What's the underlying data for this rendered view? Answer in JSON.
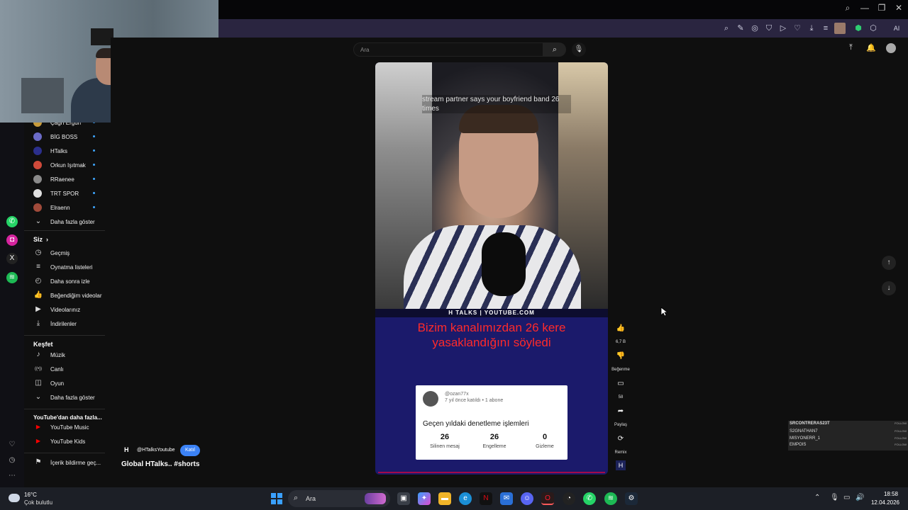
{
  "youtube": {
    "search_placeholder": "Ara",
    "sidebar": {
      "subscriptions": [
        {
          "label": "Çağrı Ergün",
          "color": "#c79b3b"
        },
        {
          "label": "BİG BOSS",
          "color": "#6b6bc7"
        },
        {
          "label": "HTalks",
          "color": "#2b2f8c"
        },
        {
          "label": "Orkun Işıtmak",
          "color": "#d04a3a"
        },
        {
          "label": "RRaenee",
          "color": "#8a8a8a"
        },
        {
          "label": "TRT SPOR",
          "color": "#e0e0e0"
        },
        {
          "label": "Elraenn",
          "color": "#a04a3a"
        }
      ],
      "show_more": "Daha fazla göster",
      "you_title": "Siz",
      "you_items": [
        {
          "label": "Geçmiş",
          "icon": "history-icon"
        },
        {
          "label": "Oynatma listeleri",
          "icon": "playlist-icon"
        },
        {
          "label": "Daha sonra izle",
          "icon": "clock-icon"
        },
        {
          "label": "Beğendiğim videolar",
          "icon": "like-icon"
        },
        {
          "label": "Videolarınız",
          "icon": "video-icon"
        },
        {
          "label": "İndirilenler",
          "icon": "download-icon"
        }
      ],
      "explore_title": "Keşfet",
      "explore_items": [
        {
          "label": "Müzik",
          "icon": "music-icon"
        },
        {
          "label": "Canlı",
          "icon": "live-icon"
        },
        {
          "label": "Oyun",
          "icon": "gamepad-icon"
        },
        {
          "label": "Daha fazla göster",
          "icon": "chevron-down-icon"
        }
      ],
      "more_title": "YouTube'dan daha fazla...",
      "more_items": [
        {
          "label": "YouTube Music",
          "color": "#ff0000"
        },
        {
          "label": "YouTube Kids",
          "color": "#ff0000"
        }
      ],
      "report_label": "İçerik bildirme geç..."
    },
    "short": {
      "caption": "stream partner says your boyfriend band 26 times",
      "banner": "H TALKS | YOUTUBE.COM",
      "red_text_line1": "Bizim kanalımızdan 26 kere",
      "red_text_line2": "yasaklandığını söyledi",
      "card": {
        "name": "@ozan77x",
        "meta": "7 yıl önce katıldı • 1 abone",
        "title": "Geçen yıldaki denetleme işlemleri",
        "stats": [
          {
            "value": "26",
            "label": "Silinen mesaj"
          },
          {
            "value": "26",
            "label": "Engelleme"
          },
          {
            "value": "0",
            "label": "Gizleme"
          }
        ]
      },
      "actions": {
        "like_count": "6,7 B",
        "dislike_label": "Beğenme",
        "comment_count": "58",
        "share_label": "Paylaş",
        "remix_label": "Remix"
      },
      "channel_handle": "@HTalksYoutube",
      "join_label": "Katıl",
      "title": "Global HTalks.. #shorts"
    }
  },
  "follow_overlay": {
    "rows": [
      {
        "name": "SRCONTRERAS23T",
        "btn": "FOLLOW"
      },
      {
        "name": "S2GNATHAN7",
        "btn": "FOLLOW"
      },
      {
        "name": "MISYONERR_1",
        "btn": "FOLLOW"
      },
      {
        "name": "EMPOIS",
        "btn": "FOLLOW"
      }
    ]
  },
  "browser": {
    "ai_label": "AI"
  },
  "taskbar": {
    "temperature": "16°C",
    "weather": "Çok bulutlu",
    "search_label": "Ara",
    "time": "18:58",
    "date": "12.04.2026"
  }
}
